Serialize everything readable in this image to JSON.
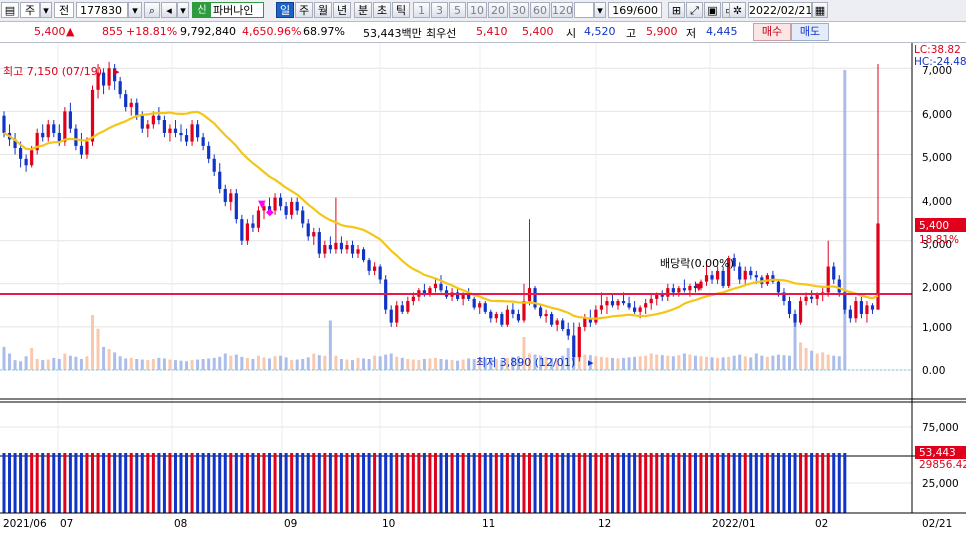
{
  "toolbar": {
    "market": "주",
    "price_kind": "전",
    "code": "177830",
    "shin_badge": "신",
    "name": "파버나인",
    "periods": [
      "일",
      "주",
      "월",
      "년",
      "분",
      "초",
      "틱"
    ],
    "active_period": "일",
    "intervals": [
      "1",
      "3",
      "5",
      "10",
      "20",
      "30",
      "60",
      "120"
    ],
    "count": "169",
    "count_total": "/600",
    "date": "2022/02/21"
  },
  "info": {
    "price": "5,400",
    "change": "855",
    "change_pct": "+18.81%",
    "volume": "9,792,840",
    "volume_pct": "4,650.96%",
    "ratio": "68.97%",
    "amount": "53,443백만",
    "best_ask_label": "최우선",
    "best_ask": "5,410",
    "best_bid": "5,400",
    "open_label": "시",
    "open": "4,520",
    "high_label": "고",
    "high": "5,900",
    "low_label": "저",
    "low": "4,445",
    "buy_label": "매수",
    "sell_label": "매도"
  },
  "annotations": {
    "high": "최고 7,150 (07/19)",
    "low": "최저 3,890 (12/01)",
    "dividend": "배당락(0.00%)"
  },
  "right_axis": {
    "lc": "LC:38.82",
    "hc": "HC:-24.48",
    "price_ticks": [
      "7,000",
      "6,000",
      "5,000",
      "4,000",
      "3,000",
      "2,000",
      "1,000",
      "0.00"
    ],
    "current_price": "5,400",
    "current_pct": "18.81%",
    "volume_ticks": [
      "75,000",
      "50,000",
      "25,000"
    ],
    "current_volume": "53,443",
    "volume_ma": "29856.42"
  },
  "x_axis": [
    "2021/06",
    "07",
    "08",
    "09",
    "10",
    "11",
    "12",
    "2022/01",
    "02",
    "02/21"
  ],
  "colors": {
    "up": "#E0001B",
    "down": "#1034C8",
    "ma": "#F5C518",
    "support": "#E8184A",
    "vol_up": "#F7C0A0",
    "vol_down": "#9DB2E8"
  },
  "chart_data": {
    "type": "candlestick",
    "x_start": "2021-06-01",
    "x_end": "2022-02-21",
    "candles": [
      {
        "o": 5900,
        "h": 6000,
        "l": 5400,
        "c": 5500
      },
      {
        "o": 5500,
        "h": 5700,
        "l": 5200,
        "c": 5350
      },
      {
        "o": 5350,
        "h": 5500,
        "l": 5000,
        "c": 5150
      },
      {
        "o": 5150,
        "h": 5300,
        "l": 4700,
        "c": 4900
      },
      {
        "o": 4900,
        "h": 5000,
        "l": 4600,
        "c": 4750
      },
      {
        "o": 4750,
        "h": 5200,
        "l": 4700,
        "c": 5100
      },
      {
        "o": 5100,
        "h": 5600,
        "l": 5000,
        "c": 5500
      },
      {
        "o": 5500,
        "h": 5700,
        "l": 5300,
        "c": 5400
      },
      {
        "o": 5400,
        "h": 5800,
        "l": 5300,
        "c": 5700
      },
      {
        "o": 5700,
        "h": 5800,
        "l": 5400,
        "c": 5500
      },
      {
        "o": 5500,
        "h": 5700,
        "l": 5200,
        "c": 5300
      },
      {
        "o": 5300,
        "h": 6100,
        "l": 5200,
        "c": 6000
      },
      {
        "o": 6000,
        "h": 6200,
        "l": 5500,
        "c": 5600
      },
      {
        "o": 5600,
        "h": 5700,
        "l": 5100,
        "c": 5200
      },
      {
        "o": 5200,
        "h": 5500,
        "l": 4900,
        "c": 5000
      },
      {
        "o": 5000,
        "h": 5400,
        "l": 4900,
        "c": 5300
      },
      {
        "o": 5300,
        "h": 6600,
        "l": 5200,
        "c": 6500
      },
      {
        "o": 6500,
        "h": 7100,
        "l": 6300,
        "c": 6900
      },
      {
        "o": 6900,
        "h": 7000,
        "l": 6400,
        "c": 6600
      },
      {
        "o": 6600,
        "h": 7150,
        "l": 6500,
        "c": 7000
      },
      {
        "o": 7000,
        "h": 7100,
        "l": 6500,
        "c": 6700
      },
      {
        "o": 6700,
        "h": 6800,
        "l": 6300,
        "c": 6400
      },
      {
        "o": 6400,
        "h": 6500,
        "l": 6000,
        "c": 6100
      },
      {
        "o": 6100,
        "h": 6300,
        "l": 5900,
        "c": 6200
      },
      {
        "o": 6200,
        "h": 6300,
        "l": 5800,
        "c": 5900
      },
      {
        "o": 5900,
        "h": 6000,
        "l": 5500,
        "c": 5600
      },
      {
        "o": 5600,
        "h": 5800,
        "l": 5400,
        "c": 5700
      },
      {
        "o": 5700,
        "h": 6000,
        "l": 5600,
        "c": 5900
      },
      {
        "o": 5900,
        "h": 6100,
        "l": 5700,
        "c": 5800
      },
      {
        "o": 5800,
        "h": 5900,
        "l": 5400,
        "c": 5500
      },
      {
        "o": 5500,
        "h": 5700,
        "l": 5300,
        "c": 5600
      },
      {
        "o": 5600,
        "h": 5800,
        "l": 5400,
        "c": 5500
      },
      {
        "o": 5500,
        "h": 5700,
        "l": 5300,
        "c": 5450
      },
      {
        "o": 5450,
        "h": 5600,
        "l": 5200,
        "c": 5300
      },
      {
        "o": 5300,
        "h": 5800,
        "l": 5200,
        "c": 5700
      },
      {
        "o": 5700,
        "h": 5800,
        "l": 5300,
        "c": 5400
      },
      {
        "o": 5400,
        "h": 5500,
        "l": 5100,
        "c": 5200
      },
      {
        "o": 5200,
        "h": 5300,
        "l": 4800,
        "c": 4900
      },
      {
        "o": 4900,
        "h": 5000,
        "l": 4500,
        "c": 4600
      },
      {
        "o": 4600,
        "h": 4800,
        "l": 4100,
        "c": 4200
      },
      {
        "o": 4200,
        "h": 4300,
        "l": 3800,
        "c": 3900
      },
      {
        "o": 3900,
        "h": 4200,
        "l": 3700,
        "c": 4100
      },
      {
        "o": 4100,
        "h": 4200,
        "l": 3400,
        "c": 3500
      },
      {
        "o": 3500,
        "h": 3600,
        "l": 2900,
        "c": 3000
      },
      {
        "o": 3000,
        "h": 3500,
        "l": 2900,
        "c": 3400
      },
      {
        "o": 3400,
        "h": 3600,
        "l": 3200,
        "c": 3300
      },
      {
        "o": 3300,
        "h": 3800,
        "l": 3200,
        "c": 3700
      },
      {
        "o": 3700,
        "h": 3900,
        "l": 3500,
        "c": 3800
      },
      {
        "o": 3800,
        "h": 4000,
        "l": 3600,
        "c": 3700
      },
      {
        "o": 3700,
        "h": 4100,
        "l": 3600,
        "c": 4000
      },
      {
        "o": 4000,
        "h": 4100,
        "l": 3700,
        "c": 3800
      },
      {
        "o": 3800,
        "h": 3900,
        "l": 3500,
        "c": 3600
      },
      {
        "o": 3600,
        "h": 4000,
        "l": 3500,
        "c": 3900
      },
      {
        "o": 3900,
        "h": 4000,
        "l": 3600,
        "c": 3700
      },
      {
        "o": 3700,
        "h": 3800,
        "l": 3300,
        "c": 3400
      },
      {
        "o": 3400,
        "h": 3500,
        "l": 3000,
        "c": 3100
      },
      {
        "o": 3100,
        "h": 3300,
        "l": 2900,
        "c": 3200
      },
      {
        "o": 3200,
        "h": 3300,
        "l": 2600,
        "c": 2700
      },
      {
        "o": 2700,
        "h": 3000,
        "l": 2600,
        "c": 2900
      },
      {
        "o": 2900,
        "h": 3100,
        "l": 2700,
        "c": 2800
      },
      {
        "o": 2800,
        "h": 4000,
        "l": 2700,
        "c": 2950
      },
      {
        "o": 2950,
        "h": 3100,
        "l": 2700,
        "c": 2800
      },
      {
        "o": 2800,
        "h": 3000,
        "l": 2700,
        "c": 2900
      },
      {
        "o": 2900,
        "h": 3000,
        "l": 2600,
        "c": 2700
      },
      {
        "o": 2700,
        "h": 2900,
        "l": 2600,
        "c": 2800
      },
      {
        "o": 2800,
        "h": 2850,
        "l": 2500,
        "c": 2550
      },
      {
        "o": 2550,
        "h": 2600,
        "l": 2200,
        "c": 2300
      },
      {
        "o": 2300,
        "h": 2500,
        "l": 2200,
        "c": 2400
      },
      {
        "o": 2400,
        "h": 2450,
        "l": 2000,
        "c": 2100
      },
      {
        "o": 2100,
        "h": 2200,
        "l": 1300,
        "c": 1400
      },
      {
        "o": 1400,
        "h": 1500,
        "l": 1000,
        "c": 1100
      },
      {
        "o": 1100,
        "h": 1600,
        "l": 1000,
        "c": 1500
      },
      {
        "o": 1500,
        "h": 1600,
        "l": 1300,
        "c": 1350
      },
      {
        "o": 1350,
        "h": 1700,
        "l": 1300,
        "c": 1600
      },
      {
        "o": 1600,
        "h": 1800,
        "l": 1500,
        "c": 1700
      },
      {
        "o": 1700,
        "h": 1900,
        "l": 1600,
        "c": 1850
      },
      {
        "o": 1850,
        "h": 2000,
        "l": 1700,
        "c": 1750
      },
      {
        "o": 1750,
        "h": 1950,
        "l": 1700,
        "c": 1900
      },
      {
        "o": 1900,
        "h": 2100,
        "l": 1800,
        "c": 2000
      },
      {
        "o": 2000,
        "h": 2200,
        "l": 1800,
        "c": 1850
      },
      {
        "o": 1850,
        "h": 1950,
        "l": 1650,
        "c": 1700
      },
      {
        "o": 1700,
        "h": 1900,
        "l": 1600,
        "c": 1800
      },
      {
        "o": 1800,
        "h": 1900,
        "l": 1600,
        "c": 1650
      },
      {
        "o": 1650,
        "h": 1800,
        "l": 1500,
        "c": 1750
      },
      {
        "o": 1750,
        "h": 1900,
        "l": 1600,
        "c": 1650
      },
      {
        "o": 1650,
        "h": 1700,
        "l": 1400,
        "c": 1450
      },
      {
        "o": 1450,
        "h": 1600,
        "l": 1300,
        "c": 1550
      },
      {
        "o": 1550,
        "h": 1600,
        "l": 1300,
        "c": 1350
      },
      {
        "o": 1350,
        "h": 1400,
        "l": 1100,
        "c": 1200
      },
      {
        "o": 1200,
        "h": 1350,
        "l": 1100,
        "c": 1300
      },
      {
        "o": 1300,
        "h": 1350,
        "l": 1000,
        "c": 1050
      },
      {
        "o": 1050,
        "h": 1500,
        "l": 1000,
        "c": 1400
      },
      {
        "o": 1400,
        "h": 1550,
        "l": 1200,
        "c": 1300
      },
      {
        "o": 1300,
        "h": 1400,
        "l": 1100,
        "c": 1150
      },
      {
        "o": 1150,
        "h": 2000,
        "l": 1100,
        "c": 1600
      },
      {
        "o": 1600,
        "h": 3500,
        "l": 1500,
        "c": 1900
      },
      {
        "o": 1900,
        "h": 1950,
        "l": 1400,
        "c": 1450
      },
      {
        "o": 1450,
        "h": 1500,
        "l": 1200,
        "c": 1250
      },
      {
        "o": 1250,
        "h": 1400,
        "l": 1100,
        "c": 1300
      },
      {
        "o": 1300,
        "h": 1350,
        "l": 1000,
        "c": 1050
      },
      {
        "o": 1050,
        "h": 1200,
        "l": 900,
        "c": 1150
      },
      {
        "o": 1150,
        "h": 1200,
        "l": 900,
        "c": 950
      },
      {
        "o": 950,
        "h": 1100,
        "l": 700,
        "c": 800
      },
      {
        "o": 800,
        "h": 1100,
        "l": 100,
        "c": 300
      },
      {
        "o": 300,
        "h": 1100,
        "l": 200,
        "c": 1000
      },
      {
        "o": 1000,
        "h": 1300,
        "l": 900,
        "c": 1200
      },
      {
        "o": 1200,
        "h": 1400,
        "l": 1000,
        "c": 1100
      },
      {
        "o": 1100,
        "h": 1500,
        "l": 1050,
        "c": 1400
      },
      {
        "o": 1400,
        "h": 1800,
        "l": 1300,
        "c": 1500
      },
      {
        "o": 1500,
        "h": 1700,
        "l": 1300,
        "c": 1600
      },
      {
        "o": 1600,
        "h": 1750,
        "l": 1450,
        "c": 1500
      },
      {
        "o": 1500,
        "h": 1650,
        "l": 1400,
        "c": 1600
      },
      {
        "o": 1600,
        "h": 1800,
        "l": 1500,
        "c": 1550
      },
      {
        "o": 1550,
        "h": 1700,
        "l": 1400,
        "c": 1450
      },
      {
        "o": 1450,
        "h": 1600,
        "l": 1300,
        "c": 1350
      },
      {
        "o": 1350,
        "h": 1500,
        "l": 1200,
        "c": 1450
      },
      {
        "o": 1450,
        "h": 1650,
        "l": 1300,
        "c": 1550
      },
      {
        "o": 1550,
        "h": 1750,
        "l": 1400,
        "c": 1650
      },
      {
        "o": 1650,
        "h": 1800,
        "l": 1500,
        "c": 1750
      },
      {
        "o": 1750,
        "h": 1850,
        "l": 1600,
        "c": 1700
      },
      {
        "o": 1700,
        "h": 2000,
        "l": 1600,
        "c": 1900
      },
      {
        "o": 1900,
        "h": 2000,
        "l": 1700,
        "c": 1800
      },
      {
        "o": 1800,
        "h": 1950,
        "l": 1700,
        "c": 1900
      },
      {
        "o": 1900,
        "h": 2100,
        "l": 1800,
        "c": 1850
      },
      {
        "o": 1850,
        "h": 2000,
        "l": 1700,
        "c": 1950
      },
      {
        "o": 1950,
        "h": 2050,
        "l": 1800,
        "c": 1900
      },
      {
        "o": 1900,
        "h": 2100,
        "l": 1850,
        "c": 2050
      },
      {
        "o": 2050,
        "h": 2500,
        "l": 1950,
        "c": 2200
      },
      {
        "o": 2200,
        "h": 2300,
        "l": 2000,
        "c": 2100
      },
      {
        "o": 2100,
        "h": 2400,
        "l": 2000,
        "c": 2300
      },
      {
        "o": 2300,
        "h": 2400,
        "l": 1900,
        "c": 1950
      },
      {
        "o": 1950,
        "h": 2650,
        "l": 1900,
        "c": 2600
      },
      {
        "o": 2600,
        "h": 2700,
        "l": 2300,
        "c": 2400
      },
      {
        "o": 2400,
        "h": 2500,
        "l": 2000,
        "c": 2100
      },
      {
        "o": 2100,
        "h": 2400,
        "l": 2000,
        "c": 2300
      },
      {
        "o": 2300,
        "h": 2400,
        "l": 2100,
        "c": 2200
      },
      {
        "o": 2200,
        "h": 2300,
        "l": 2000,
        "c": 2150
      },
      {
        "o": 2150,
        "h": 2200,
        "l": 1900,
        "c": 2000
      },
      {
        "o": 2000,
        "h": 2250,
        "l": 1950,
        "c": 2200
      },
      {
        "o": 2200,
        "h": 2300,
        "l": 2000,
        "c": 2050
      },
      {
        "o": 2050,
        "h": 2100,
        "l": 1700,
        "c": 1800
      },
      {
        "o": 1800,
        "h": 1900,
        "l": 1500,
        "c": 1600
      },
      {
        "o": 1600,
        "h": 1700,
        "l": 1200,
        "c": 1300
      },
      {
        "o": 1300,
        "h": 1400,
        "l": 1000,
        "c": 1100
      },
      {
        "o": 1100,
        "h": 1700,
        "l": 1050,
        "c": 1600
      },
      {
        "o": 1600,
        "h": 1800,
        "l": 1500,
        "c": 1700
      },
      {
        "o": 1700,
        "h": 1850,
        "l": 1550,
        "c": 1650
      },
      {
        "o": 1650,
        "h": 1800,
        "l": 1500,
        "c": 1750
      },
      {
        "o": 1750,
        "h": 1900,
        "l": 1600,
        "c": 1800
      },
      {
        "o": 1800,
        "h": 3000,
        "l": 1700,
        "c": 2400
      },
      {
        "o": 2400,
        "h": 2500,
        "l": 2000,
        "c": 2100
      },
      {
        "o": 2100,
        "h": 2200,
        "l": 1700,
        "c": 1800
      },
      {
        "o": 1800,
        "h": 1850,
        "l": 1300,
        "c": 1400
      },
      {
        "o": 1400,
        "h": 1500,
        "l": 1100,
        "c": 1200
      },
      {
        "o": 1200,
        "h": 1700,
        "l": 1100,
        "c": 1600
      },
      {
        "o": 1600,
        "h": 1700,
        "l": 1200,
        "c": 1300
      },
      {
        "o": 1300,
        "h": 1600,
        "l": 1100,
        "c": 1500
      },
      {
        "o": 1500,
        "h": 1550,
        "l": 1300,
        "c": 1400
      },
      {
        "o": 1400,
        "h": 7100,
        "l": 1400,
        "c": 3400
      }
    ],
    "volumes": [
      420,
      300,
      180,
      160,
      250,
      400,
      200,
      180,
      190,
      220,
      200,
      300,
      260,
      240,
      200,
      250,
      1000,
      750,
      420,
      380,
      320,
      250,
      210,
      220,
      200,
      190,
      180,
      200,
      220,
      210,
      190,
      180,
      170,
      160,
      180,
      190,
      200,
      210,
      220,
      240,
      300,
      260,
      280,
      240,
      220,
      200,
      260,
      230,
      210,
      250,
      260,
      230,
      180,
      190,
      200,
      230,
      300,
      270,
      260,
      900,
      260,
      200,
      190,
      180,
      220,
      210,
      200,
      260,
      250,
      280,
      300,
      240,
      220,
      200,
      190,
      180,
      200,
      210,
      220,
      200,
      190,
      180,
      170,
      190,
      210,
      200,
      230,
      220,
      210,
      200,
      180,
      220,
      240,
      250,
      600,
      300,
      280,
      260,
      240,
      220,
      210,
      260,
      400,
      350,
      300,
      280,
      270,
      250,
      240,
      230,
      220,
      210,
      220,
      230,
      240,
      250,
      260,
      300,
      280,
      270,
      260,
      250,
      270,
      300,
      280,
      260,
      250,
      240,
      230,
      220,
      230,
      240,
      260,
      280,
      250,
      230,
      300,
      260,
      240,
      260,
      280,
      270,
      260,
      1000,
      500,
      400,
      350,
      300,
      320,
      280,
      260,
      250,
      9792
    ],
    "volume_unit": "thousand shares"
  }
}
